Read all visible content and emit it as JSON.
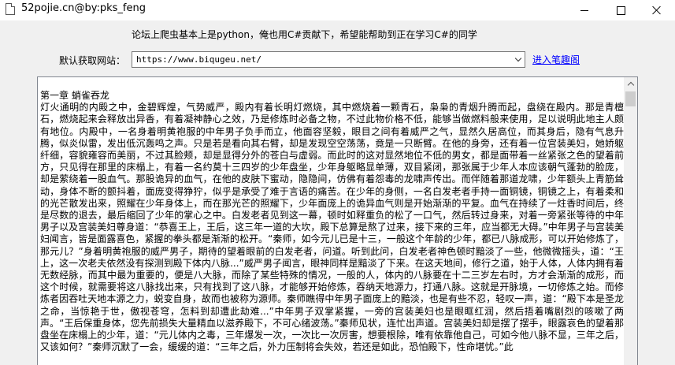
{
  "window": {
    "title": "52pojie.cn@by:pks_feng",
    "controls": {
      "minimize": "—",
      "maximize": "☐",
      "close": "✕"
    }
  },
  "header": {
    "note": "论坛上爬虫基本上是python，俺也用C#贡献下，希望能帮助到正在学习C#的同学"
  },
  "url_row": {
    "label": "默认获取网站：",
    "url_value": "https://www.biqugeu.net/",
    "enter_link": "进入笔趣阁"
  },
  "content": {
    "chapter_title": "第一章 蛸雀吞龙",
    "body": "灯火通明的内殿之中，金碧辉煌，气势威严，殿内有着长明灯燃烧，其中燃烧着一颗青石，枭枭的青烟升腾而起，盘绕在殿内。那是青檀石，燃烧起来会释放出异香，有着凝神静心之效，乃是修炼时必备之物，不过此物价格不低，能够当做燃料般来使用，足以说明此地主人颇有地位。内殿中，一名身着明黄袍服的中年男子负手而立，他面容坚毅，眼目之间有着威严之气，显然久居高位，而其身后，隐有气息升腾，似炎似雷，发出低沉轰鸣之声。只是若是看向其右臂，却是发现空空荡荡，竟是一只断臂。在他的身旁，还有着一位宫装美妇，她娇躯纤细，容貌雍容而美丽，不过其脸颊，却是显得分外的苍白与虚弱。而此时的这对显然地位不低的男女，都是面带着一丝紧张之色的望着前方，只见得在那里的床榻上，有着一名约莫十三四岁的少年盘坐，少年身躯略显单薄，双目紧闭，那张属于少年人本应该朝气蓬勃的脸庞，却是萦绕着一股血气。那股诡异的血气，在他的皮肤下蜜动，隐隐间，仿佛有着怨毒的龙啸声传出。而伴随着那道龙啸，少年额头上青筋耸动，身体不断的颤抖着，面庞变得狰狞，似乎是承受了难于言语的痛苦。在少年的身侧，一名白发老者手持一面铜镜，铜镜之上，有着柔和的光芒散发出来，照耀在少年身体上，而在那光芒的照耀下，少年面庞上的诡异血气则是开始渐渐的平复。血气在持续了一炷香时间后，终是尽数的退去，最后缩回了少年的掌心之中。白发老者见到这一幕，顿时如释重负的松了一口气，然后转过身来，对着一旁紧张等待的中年男子以及宫装美妇尊身道：“恭喜王上，王后，这三年一道的大坎，殿下总算是熬了过来，接下来的三年，应当都无大碍。”中年男子与宫装美妇闻言，皆是面露喜色，紧握的拳头都是渐渐的松开。“秦师，如今元儿已是十三，一般这个年龄的少年，都已八脉成形，可以开始修炼了，那元儿？”身着明黄袍服的威严男子，期待的望着眼前的白发老者，问道。听到此问，白发老者神色顿时黯淡了一些，他微微摇头，道：“王上，这一次老夫依然没有探测到殿下体内八脉...”威严男子闻言，眼神同样是黯淡了下来。在这天地间，修行之道，始于人体，人体内拥有着无数经脉，而其中最为重要的，便是八大脉，而除了某些特殊的情况，一般的人，体内的八脉要在十二三岁左右时，方才会渐渐的成形，而这个时候，就需要将这八脉找出来，只有找到了这八脉，才能够开始修炼，吞纳天地源力，打通八脉。这就是开脉境，一切修炼之始。而修炼者因吞吐天地本源之力，蜕变自身，故而也被称为源师。秦师瞧得中年男子面庞上的黯淡，也是有些不忍，轻叹一声，道：“殿下本是圣龙之命，当惊艳于世，傲视苍穹，怎料到却遭此劫难...”中年男子双掌紧握，一旁的宫装美妇也是眼眶红润，然后捂着嘴剧烈的咳嗽了两声。“王后保重身体，您先前损失大量精血以滋养殿下，不可心绪波荡。”秦师见状，连忙出声道。宫装美妇却是摆了摆手，眼露哀色的望着那盘坐在床榻上的少年，道：“元儿体内之毒，三年爆发一次，一次比一次厉害，想要根除，唯有依靠他自己，可如今他八脉不显，三年之后，又该如何？”秦师沉默了一会，缓缓的道：“三年之后，外力压制将会失效，若还是如此，恐怕殿下，性命堪忧。”此"
  },
  "colors": {
    "window_bg": "#f0f0f0",
    "link": "#0000ff",
    "textbox_border": "#828790"
  }
}
